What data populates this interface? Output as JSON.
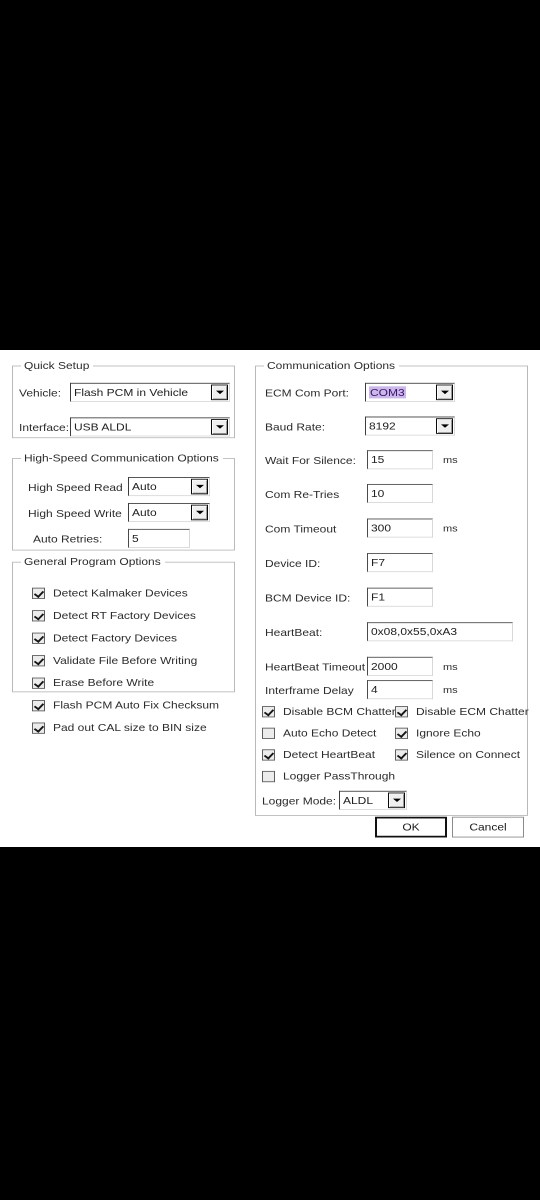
{
  "dialog": {
    "background": "#ffffff",
    "selection_bg": "#cbb8e8",
    "selection_fg": "#3a1470"
  },
  "quick_setup": {
    "title": "Quick Setup",
    "vehicle_label": "Vehicle:",
    "vehicle_value": "Flash PCM in Vehicle",
    "interface_label": "Interface:",
    "interface_value": "USB ALDL"
  },
  "high_speed": {
    "title": "High-Speed Communication Options",
    "read_label": "High Speed Read",
    "read_value": "Auto",
    "write_label": "High Speed Write",
    "write_value": "Auto",
    "retries_label": "Auto Retries:",
    "retries_value": "5"
  },
  "general_options": {
    "title": "General Program Options",
    "items": [
      {
        "label": "Detect Kalmaker Devices",
        "checked": true
      },
      {
        "label": "Detect RT Factory Devices",
        "checked": true
      },
      {
        "label": "Detect Factory Devices",
        "checked": true
      },
      {
        "label": "Validate File Before Writing",
        "checked": true
      },
      {
        "label": "Erase Before Write",
        "checked": true
      },
      {
        "label": "Flash PCM Auto Fix Checksum",
        "checked": true
      },
      {
        "label": "Pad out CAL size to BIN size",
        "checked": true
      }
    ]
  },
  "communication": {
    "title": "Communication Options",
    "ecm_com_port_label": "ECM Com Port:",
    "ecm_com_port_value": "COM3",
    "baud_rate_label": "Baud Rate:",
    "baud_rate_value": "8192",
    "wait_for_silence_label": "Wait For Silence:",
    "wait_for_silence_value": "15",
    "wait_for_silence_unit": "ms",
    "com_retries_label": "Com Re-Tries",
    "com_retries_value": "10",
    "com_timeout_label": "Com Timeout",
    "com_timeout_value": "300",
    "com_timeout_unit": "ms",
    "device_id_label": "Device ID:",
    "device_id_value": "F7",
    "bcm_device_id_label": "BCM Device ID:",
    "bcm_device_id_value": "F1",
    "heartbeat_label": "HeartBeat:",
    "heartbeat_value": "0x08,0x55,0xA3",
    "heartbeat_timeout_label": "HeartBeat Timeout",
    "heartbeat_timeout_value": "2000",
    "heartbeat_timeout_unit": "ms",
    "interframe_delay_label": "Interframe Delay",
    "interframe_delay_value": "4",
    "interframe_delay_unit": "ms",
    "checkboxes": [
      {
        "label": "Disable BCM Chatter",
        "checked": true
      },
      {
        "label": "Disable ECM Chatter",
        "checked": true
      },
      {
        "label": "Auto Echo Detect",
        "checked": false
      },
      {
        "label": "Ignore Echo",
        "checked": true
      },
      {
        "label": "Detect HeartBeat",
        "checked": true
      },
      {
        "label": "Silence on Connect",
        "checked": true
      },
      {
        "label": "Logger PassThrough",
        "checked": false
      }
    ],
    "logger_mode_label": "Logger Mode:",
    "logger_mode_value": "ALDL"
  },
  "footer": {
    "ok_label": "OK",
    "cancel_label": "Cancel"
  }
}
